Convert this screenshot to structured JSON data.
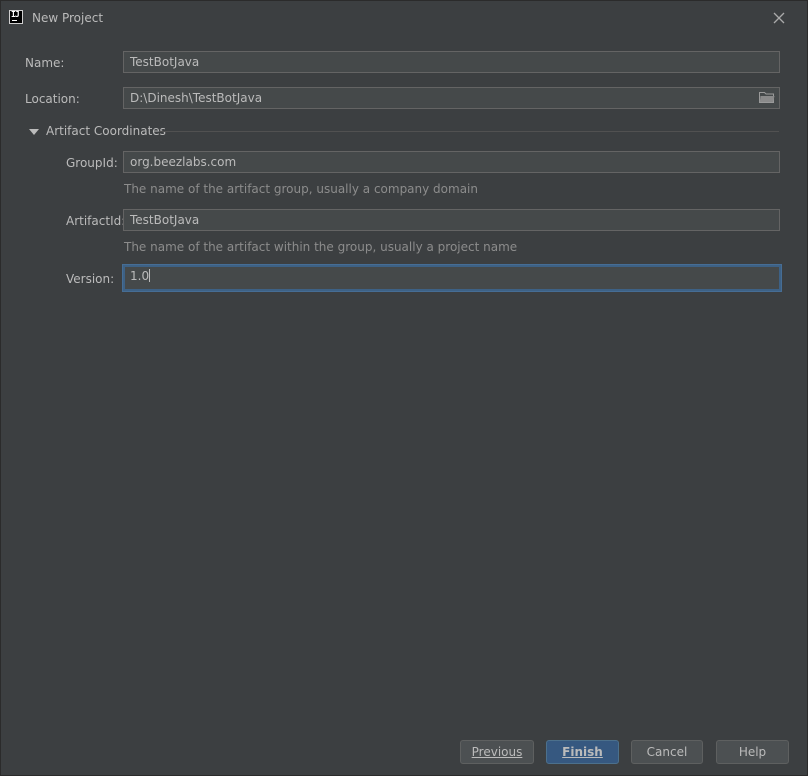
{
  "window": {
    "title": "New Project",
    "icon": "intellij-idea-icon",
    "close_icon": "close-icon"
  },
  "form": {
    "name": {
      "label": "Name:",
      "value": "TestBotJava"
    },
    "location": {
      "label": "Location:",
      "value": "D:\\Dinesh\\TestBotJava",
      "browse_icon": "folder-icon"
    },
    "artifact_section": {
      "label": "Artifact Coordinates",
      "expanded": true
    },
    "group_id": {
      "label": "GroupId:",
      "value": "org.beezlabs.com",
      "hint": "The name of the artifact group, usually a company domain"
    },
    "artifact_id": {
      "label": "ArtifactId:",
      "value": "TestBotJava",
      "hint": "The name of the artifact within the group, usually a project name"
    },
    "version": {
      "label": "Version:",
      "value": "1.0"
    }
  },
  "buttons": {
    "previous": "Previous",
    "finish": "Finish",
    "cancel": "Cancel",
    "help": "Help"
  },
  "colors": {
    "background": "#3c3f41",
    "field_background": "#45494a",
    "focus_border": "#3d6185",
    "primary_button": "#365880"
  }
}
